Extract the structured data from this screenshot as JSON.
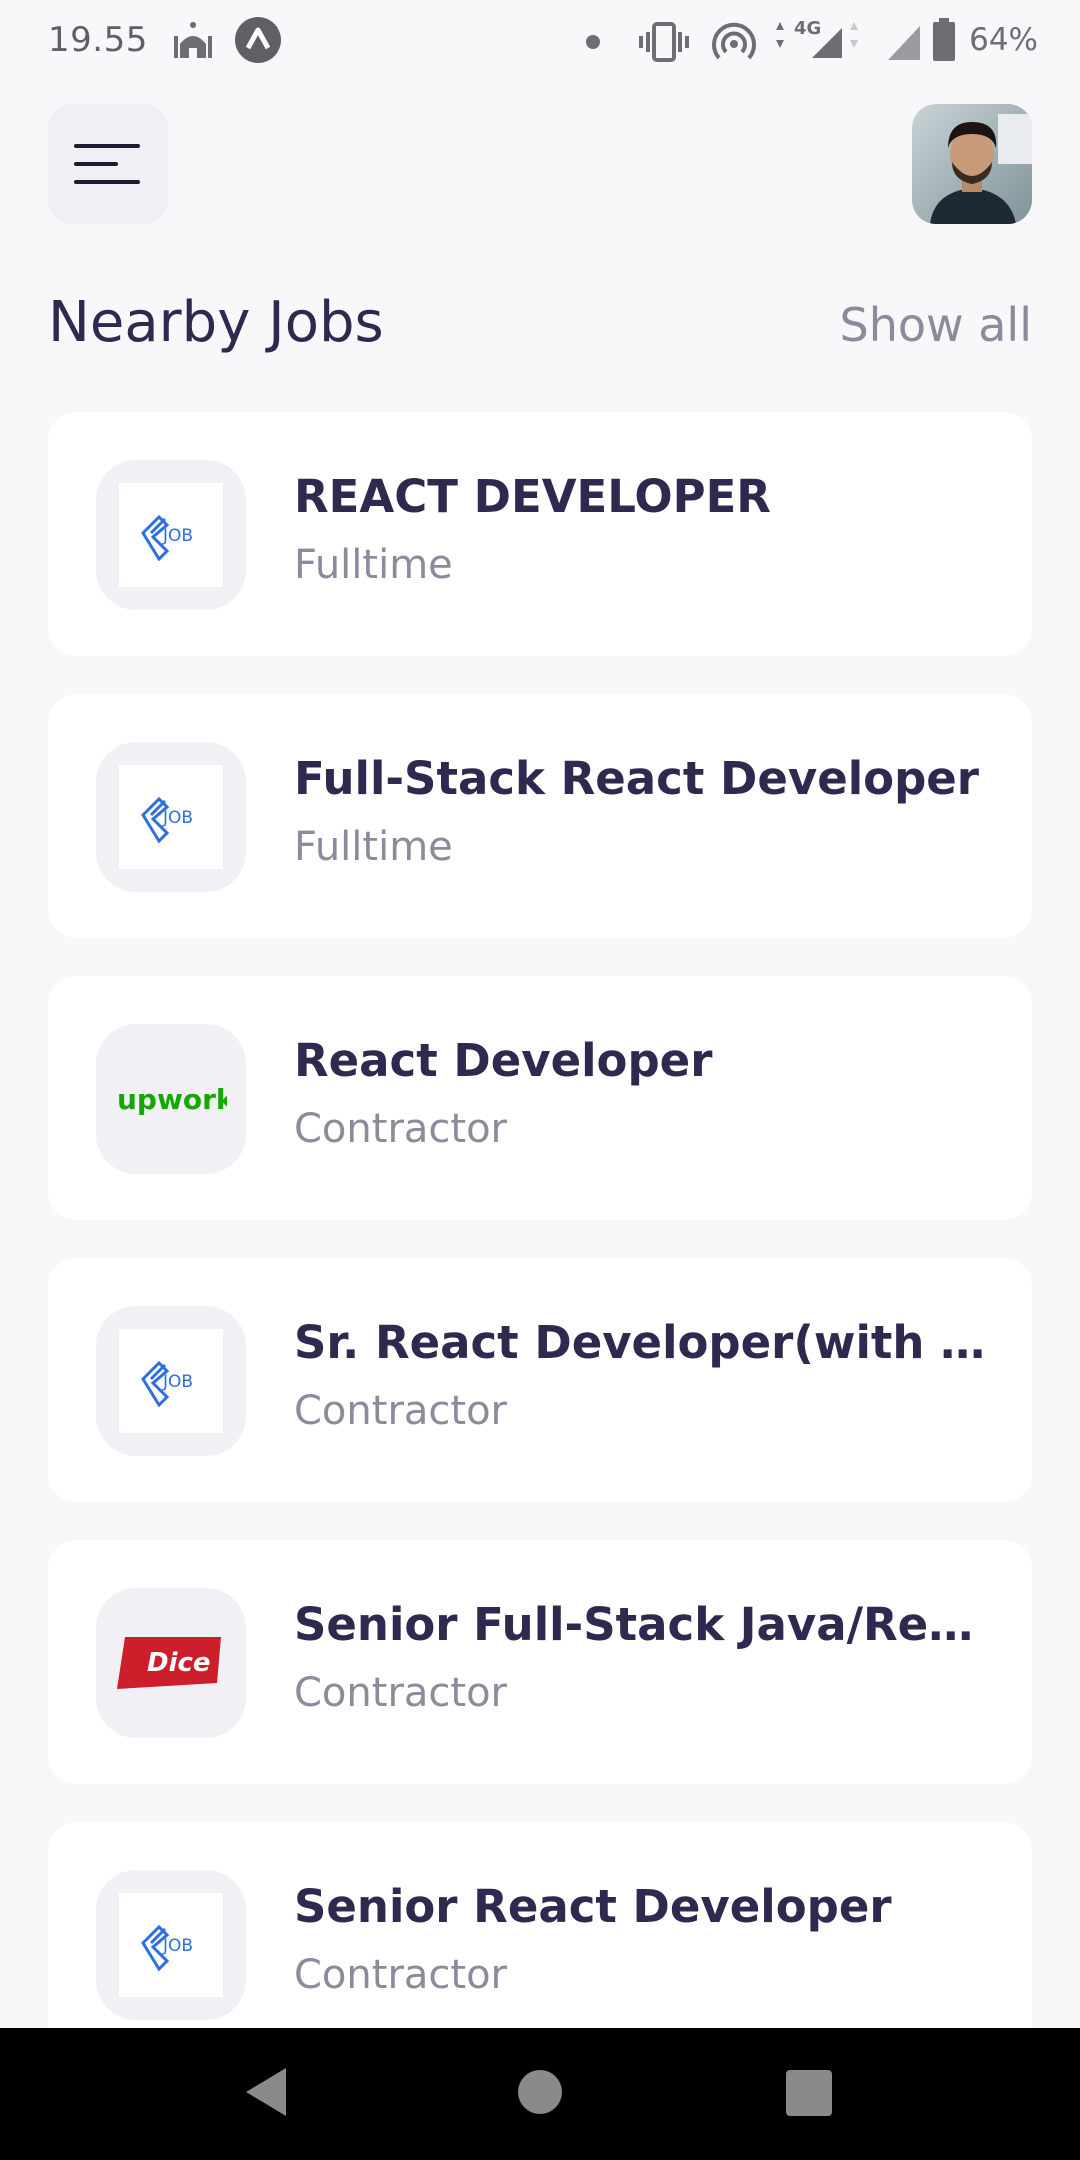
{
  "status_bar": {
    "time": "19.55",
    "battery": "64%",
    "icons": [
      "mosque-icon",
      "app-icon",
      "dot-icon",
      "vibrate-icon",
      "hotspot-icon",
      "signal-4g-icon",
      "signal-icon",
      "battery-icon"
    ]
  },
  "header": {
    "menu_icon": "menu-icon",
    "avatar": "avatar"
  },
  "section": {
    "title": "Nearby Jobs",
    "show_all": "Show all"
  },
  "jobs": [
    {
      "title": "REACT DEVELOPER",
      "type": "Fulltime",
      "logo": "job-logo"
    },
    {
      "title": "Full-Stack React Developer",
      "type": "Fulltime",
      "logo": "job-logo"
    },
    {
      "title": "React Developer",
      "type": "Contractor",
      "logo": "upwork-logo",
      "logo_text": "upwork"
    },
    {
      "title": "Sr. React Developer(with React Native)",
      "type": "Contractor",
      "logo": "job-logo"
    },
    {
      "title": "Senior Full-Stack Java/React Developer",
      "type": "Contractor",
      "logo": "dice-logo",
      "logo_text": "Dice"
    },
    {
      "title": "Senior React Developer",
      "type": "Contractor",
      "logo": "job-logo"
    }
  ],
  "job_logo_text": "JOB",
  "colors": {
    "background": "#f8f8fb",
    "card": "#ffffff",
    "title": "#2e2a4f",
    "subtitle": "#8b8b9c",
    "job_logo_blue": "#2d6fe0",
    "upwork_green": "#14a800",
    "dice_red": "#cc1f2b"
  },
  "nav": {
    "back": "back-icon",
    "home": "home-icon",
    "recents": "recents-icon"
  }
}
